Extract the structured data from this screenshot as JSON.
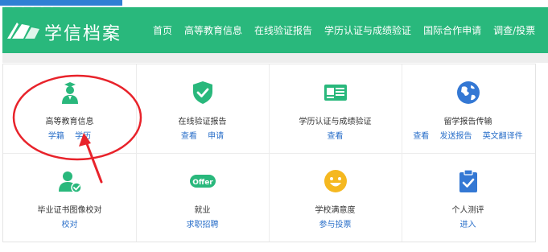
{
  "header": {
    "logo_text": "学信档案",
    "nav": [
      "首页",
      "高等教育信息",
      "在线验证报告",
      "学历认证与成绩验证",
      "国际合作申请",
      "调查/投票"
    ]
  },
  "services": [
    {
      "label": "高等教育信息",
      "links": [
        "学籍",
        "学历"
      ],
      "icon": "graduate-icon"
    },
    {
      "label": "在线验证报告",
      "links": [
        "查看",
        "申请"
      ],
      "icon": "shield-check-icon"
    },
    {
      "label": "学历认证与成绩验证",
      "links": [
        "查看"
      ],
      "icon": "id-card-icon"
    },
    {
      "label": "留学报告传输",
      "links": [
        "查看",
        "发送报告",
        "英文翻译件"
      ],
      "icon": "globe-icon"
    },
    {
      "label": "毕业证书图像校对",
      "links": [
        "校对"
      ],
      "icon": "user-check-icon"
    },
    {
      "label": "就业",
      "links": [
        "求职招聘"
      ],
      "icon": "offer-badge-icon",
      "badge_text": "Offer"
    },
    {
      "label": "学校满意度",
      "links": [
        "参与投票"
      ],
      "icon": "smiley-icon"
    },
    {
      "label": "个人测评",
      "links": [
        "进入"
      ],
      "icon": "clipboard-check-icon"
    }
  ],
  "colors": {
    "nav_green": "#29b87c",
    "icon_green": "#29b87c",
    "link_blue": "#2a6fc9",
    "globe_blue": "#3478d4",
    "smiley_yellow": "#f5b820",
    "annotation_red": "#e8232b"
  }
}
